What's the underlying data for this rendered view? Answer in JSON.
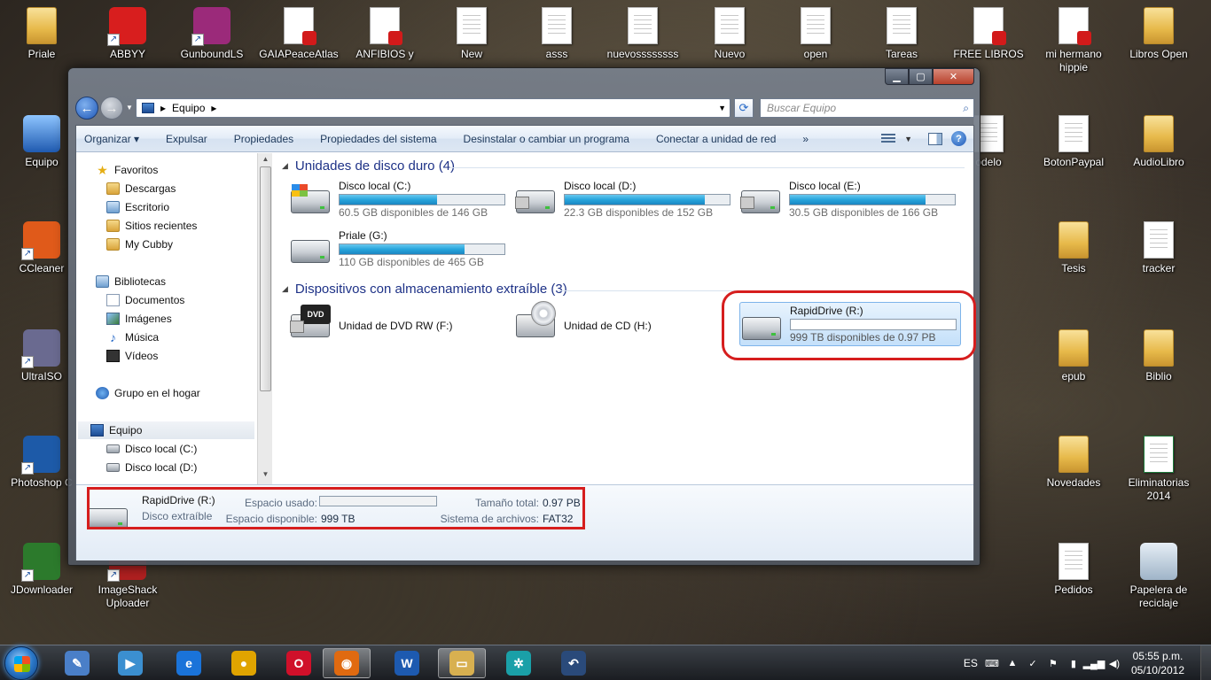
{
  "desktop": {
    "icons": [
      {
        "label": "Priale",
        "kind": "folder"
      },
      {
        "label": "ABBYY",
        "kind": "app"
      },
      {
        "label": "GunboundLS",
        "kind": "app"
      },
      {
        "label": "GAIAPeaceAtlas",
        "kind": "pdf"
      },
      {
        "label": "ANFIBIOS y",
        "kind": "pdf"
      },
      {
        "label": "New",
        "kind": "doc"
      },
      {
        "label": "asss",
        "kind": "doc"
      },
      {
        "label": "nuevossssssss",
        "kind": "doc"
      },
      {
        "label": "Nuevo",
        "kind": "doc"
      },
      {
        "label": "open",
        "kind": "doc"
      },
      {
        "label": "Tareas",
        "kind": "doc"
      },
      {
        "label": "FREE LIBROS",
        "kind": "pdf"
      },
      {
        "label": "mi hermano hippie",
        "kind": "pdf"
      },
      {
        "label": "Libros Open",
        "kind": "folder"
      },
      {
        "label": "Equipo",
        "kind": "pc"
      },
      {
        "label": "CCleaner",
        "kind": "app"
      },
      {
        "label": "UltraISO",
        "kind": "app"
      },
      {
        "label": "Photoshop C",
        "kind": "app"
      },
      {
        "label": "JDownloader",
        "kind": "app"
      },
      {
        "label": "ImageShack Uploader",
        "kind": "app"
      },
      {
        "label": "odelo",
        "kind": "doc"
      },
      {
        "label": "BotonPaypal",
        "kind": "doc"
      },
      {
        "label": "AudioLibro",
        "kind": "folder"
      },
      {
        "label": "Tesis",
        "kind": "folder"
      },
      {
        "label": "tracker",
        "kind": "doc"
      },
      {
        "label": "epub",
        "kind": "folder"
      },
      {
        "label": "Biblio",
        "kind": "folder"
      },
      {
        "label": "Novedades",
        "kind": "folder"
      },
      {
        "label": "Eliminatorias 2014",
        "kind": "excel"
      },
      {
        "label": "Pedidos",
        "kind": "doc"
      },
      {
        "label": "Papelera de reciclaje",
        "kind": "recycle"
      }
    ]
  },
  "window": {
    "controls": {
      "minimize": "▁",
      "maximize": "▢",
      "close": "✕"
    },
    "address": {
      "root_glyph": "▸",
      "location": "Equipo",
      "trail": "▸"
    },
    "search": {
      "placeholder": "Buscar Equipo"
    },
    "toolbar": {
      "items": [
        "Organizar ▾",
        "Expulsar",
        "Propiedades",
        "Propiedades del sistema",
        "Desinstalar o cambiar un programa",
        "Conectar a unidad de red",
        "»"
      ]
    },
    "nav": {
      "favorites": "Favoritos",
      "fav_items": [
        "Descargas",
        "Escritorio",
        "Sitios recientes",
        "My Cubby"
      ],
      "libraries": "Bibliotecas",
      "lib_items": [
        "Documentos",
        "Imágenes",
        "Música",
        "Vídeos"
      ],
      "homegroup": "Grupo en el hogar",
      "computer": "Equipo",
      "computer_items": [
        "Disco local (C:)",
        "Disco local (D:)",
        "Disco local (E:)",
        "Priale (G:)"
      ]
    },
    "groups": {
      "hard_drives_title": "Unidades de disco duro (4)",
      "removable_title": "Dispositivos con almacenamiento extraíble (3)"
    },
    "hard_drives": [
      {
        "name": "Disco local (C:)",
        "free": "60.5 GB disponibles de 146 GB",
        "used_fraction": 0.59
      },
      {
        "name": "Disco local (D:)",
        "free": "22.3 GB disponibles de 152 GB",
        "used_fraction": 0.85
      },
      {
        "name": "Disco local (E:)",
        "free": "30.5 GB disponibles de 166 GB",
        "used_fraction": 0.82
      },
      {
        "name": "Priale (G:)",
        "free": "110 GB disponibles de 465 GB",
        "used_fraction": 0.76
      }
    ],
    "removable": [
      {
        "name": "Unidad de DVD RW (F:)",
        "badge": "DVD"
      },
      {
        "name": "Unidad de CD (H:)"
      },
      {
        "name": "RapidDrive (R:)",
        "free": "999 TB disponibles de 0.97 PB",
        "used_fraction": 0.0
      }
    ],
    "details": {
      "name": "RapidDrive (R:)",
      "type": "Disco extraíble",
      "used_label": "Espacio usado:",
      "available_label": "Espacio disponible:",
      "available_value": "999 TB",
      "total_label": "Tamaño total:",
      "total_value": "0.97 PB",
      "fs_label": "Sistema de archivos:",
      "fs_value": "FAT32"
    }
  },
  "taskbar": {
    "language": "ES",
    "time": "05:55 p.m.",
    "date": "05/10/2012",
    "apps": [
      {
        "name": "Paint.NET",
        "glyph": "✎",
        "color": "#4a7fc8"
      },
      {
        "name": "Media Player",
        "glyph": "▶",
        "color": "#3b8fd0"
      },
      {
        "name": "Internet Explorer",
        "glyph": "e",
        "color": "#1a73d9"
      },
      {
        "name": "Chrome",
        "glyph": "●",
        "color": "#e0a400"
      },
      {
        "name": "Opera",
        "glyph": "O",
        "color": "#d0102a"
      },
      {
        "name": "Firefox",
        "glyph": "◉",
        "color": "#e06a10"
      },
      {
        "name": "Word",
        "glyph": "W",
        "color": "#1d5ab0"
      },
      {
        "name": "Explorer",
        "glyph": "▭",
        "color": "#d8b050"
      },
      {
        "name": "Compass",
        "glyph": "✲",
        "color": "#1aa0a8"
      },
      {
        "name": "Curl",
        "glyph": "↶",
        "color": "#2a4a7a"
      }
    ]
  }
}
